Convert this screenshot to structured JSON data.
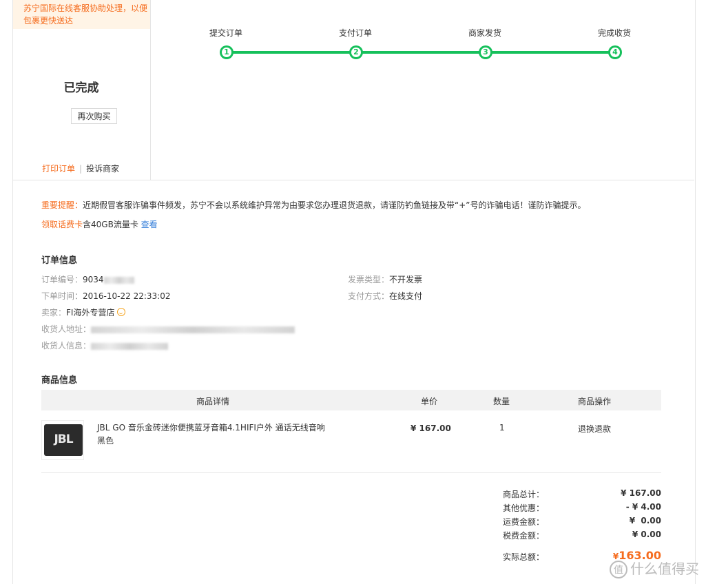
{
  "notice": {
    "text": "苏宁国际在线客服协助处理，以便包裹更快送达"
  },
  "status": {
    "text": "已完成",
    "rebuy_label": "再次购买",
    "print_label": "打印订单",
    "separator": "|",
    "complain_label": "投诉商家"
  },
  "progress": {
    "steps": [
      {
        "num": "1",
        "label": "提交订单"
      },
      {
        "num": "2",
        "label": "支付订单"
      },
      {
        "num": "3",
        "label": "商家发货"
      },
      {
        "num": "4",
        "label": "完成收货"
      }
    ],
    "color": "#16c05b"
  },
  "alerts": {
    "warning_tag": "重要提醒：",
    "warning_text": "近期假冒客服诈骗事件频发，苏宁不会以系统维护异常为由要求您办理退货退款，请谨防钓鱼链接及带“+”号的诈骗电话！谨防诈骗提示。",
    "promo_tag": "领取话费卡",
    "promo_text": "含40GB流量卡",
    "promo_link": "查看"
  },
  "order_info": {
    "title": "订单信息",
    "order_no_label": "订单编号：",
    "order_no_value": "9034",
    "time_label": "下单时间：",
    "time_value": "2016-10-22 22:33:02",
    "seller_label": "卖家：",
    "seller_value": "FI海外专营店",
    "address_label": "收货人地址：",
    "receiver_label": "收货人信息：",
    "invoice_label": "发票类型：",
    "invoice_value": "不开发票",
    "pay_label": "支付方式：",
    "pay_value": "在线支付"
  },
  "goods": {
    "title": "商品信息",
    "headers": {
      "detail": "商品详情",
      "price": "单价",
      "qty": "数量",
      "op": "商品操作"
    },
    "item": {
      "logo": "JBL",
      "name": "JBL GO 音乐金砖迷你便携蓝牙音箱4.1HIFI户外 通话无线音响 黑色",
      "price": "¥ 167.00",
      "qty": "1",
      "op": "退换退款"
    }
  },
  "totals": {
    "goods_total_label": "商品总计：",
    "goods_total": "¥ 167.00",
    "discount_label": "其他优惠：",
    "discount": "- ¥ 4.00",
    "shipping_label": "运费金额：",
    "shipping": "¥  0.00",
    "tax_label": "税费金额：",
    "tax": "¥ 0.00",
    "final_label": "实际总额：",
    "final_currency": "¥",
    "final_amount": "163.00"
  },
  "watermark": {
    "icon": "值",
    "text": "什么值得买"
  },
  "colors": {
    "accent": "#f56c1e",
    "success": "#16c05b",
    "link": "#2f7bd8"
  }
}
